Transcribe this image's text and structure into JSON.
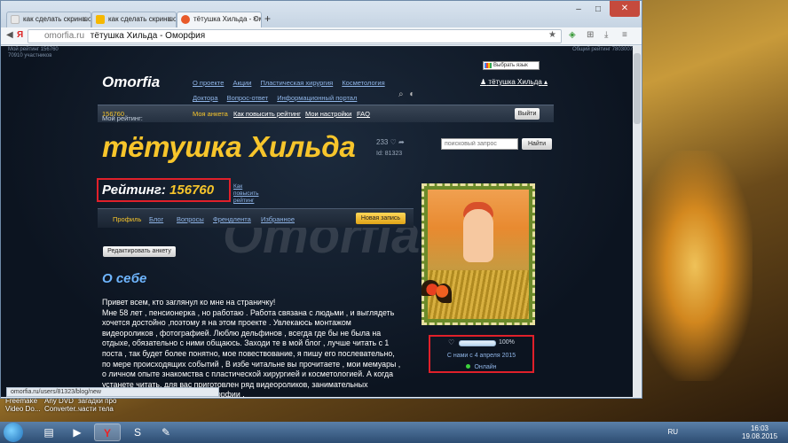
{
  "browser": {
    "tabs": [
      {
        "title": "как сделать скриншо",
        "active": false
      },
      {
        "title": "как сделать скриншо",
        "active": false
      },
      {
        "title": "тётушка Хильда - Ом",
        "active": true
      }
    ],
    "url_host": "omorfia.ru",
    "page_title": "тётушка Хильда - Оморфия",
    "status_url": "omorfia.ru/users/81323/blog/new"
  },
  "site": {
    "top_info_left_1": "Мой рейтинг 156760",
    "top_info_left_2": "70910 участников",
    "top_info_right": "Общий рейтинг 7803007",
    "logo": "Omorfia",
    "lang_select": "Выбрать язык",
    "top_menu": [
      "О проекте",
      "Акции",
      "Пластическая хирургия",
      "Косметология",
      "Доктора",
      "Вопрос-ответ",
      "Информационный портал"
    ],
    "user_name": "тётушка Хильда",
    "subnav": {
      "my_rating_label": "Мой рейтинг:",
      "my_rating_value": "156760",
      "links": [
        "Моя анкета",
        "Как повысить рейтинг",
        "Мои настройки",
        "FAQ"
      ],
      "exit": "Выйти"
    },
    "profile_name": "тётушка Хильда",
    "likes_count": "233",
    "user_id": "Id: 81323",
    "search_placeholder": "поисковый запрос",
    "search_button": "Найти",
    "rating_label": "Рейтинг:",
    "rating_value": "156760",
    "how_to_raise": "Как повысить рейтинг",
    "tabs": [
      "Профиль",
      "Блог",
      "Вопросы",
      "Френдлента",
      "Избранное"
    ],
    "new_post_button": "Новая запись",
    "edit_button": "Редактировать анкету",
    "about_title": "О себе",
    "about_lines": [
      "Привет всем, кто заглянул ко мне на страничку!",
      "Мне 58 лет , пенсионерка , но работаю . Работа связана с людьми , и выглядеть хочется достойно ,поэтому я на этом проекте . Увлекаюсь монтажом видеороликов , фотографией. Люблю дельфинов , всегда где бы не была на отдыхе, обязательно с ними общаюсь. Заходи те в мой блог , лучше читать с 1 поста , так будет более понятно, мое повествование, я пишу его послевательно, по мере происходящих событий , В избе читальне вы прочитаете , мои мемуары , о личном опыте знакомства с пластической хирургией и косметологией. А когда устанете читать, для вас приготовлен ряд видеороликов, занимательных видеороликов про жизнь на Оморфии ."
    ],
    "watermark": "Omorfia.ru",
    "profile_completion_pct": "100%",
    "profile_completion": 1.0,
    "member_since": "С нами с 4 апреля 2015",
    "online_status": "Онлайн"
  },
  "desktop_icons": [
    {
      "label": "Freemake Video Do..."
    },
    {
      "label": "Any DVD Converter..."
    },
    {
      "label": "загадки про части тела"
    }
  ],
  "taskbar": {
    "lang": "RU",
    "time": "16:03",
    "date": "19.08.2015"
  },
  "colors": {
    "accent_yellow": "#f7c52b",
    "link_blue": "#8fb4e6",
    "highlight_red": "#e0202a",
    "site_bg": "#0c1420"
  }
}
